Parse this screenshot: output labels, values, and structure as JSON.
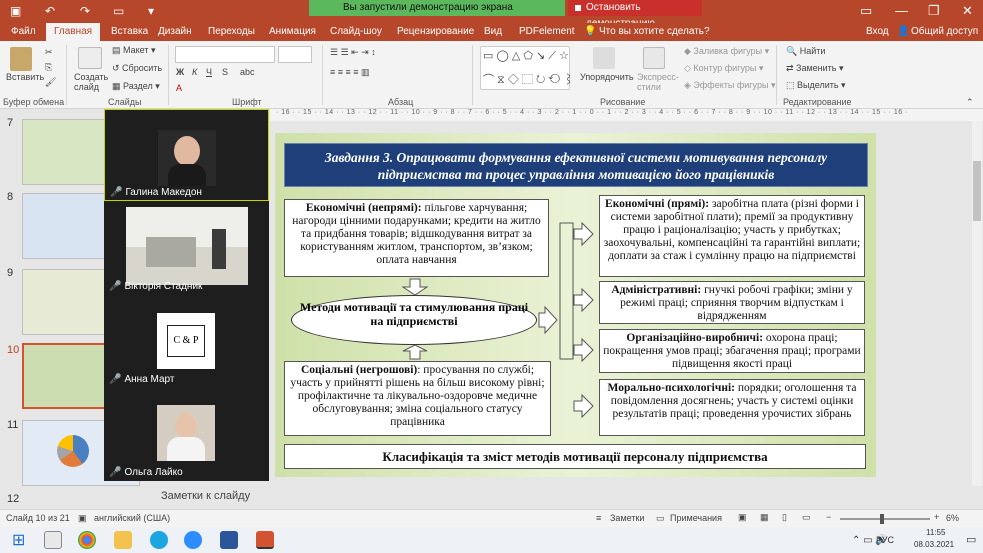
{
  "titlebar": {
    "share_banner": "Вы запустили демонстрацию экрана",
    "stop_banner": "Остановить демонстрацию"
  },
  "tabs": [
    "Файл",
    "Главная",
    "Вставка",
    "Дизайн",
    "Переходы",
    "Анимация",
    "Слайд-шоу",
    "Рецензирование",
    "Вид",
    "PDFelement"
  ],
  "tell_me": "Что вы хотите сделать?",
  "signin": "Вход",
  "share": "Общий доступ",
  "ribbon": {
    "paste": "Вставить",
    "clipboard": "Буфер обмена",
    "create_slide": "Создать слайд",
    "layout": "Макет",
    "reset": "Сбросить",
    "section": "Раздел",
    "slides": "Слайды",
    "font": "Шрифт",
    "paragraph": "Абзац",
    "arrange": "Упорядочить",
    "quick_styles": "Экспресс-стили",
    "shape_fill": "Заливка фигуры",
    "shape_outline": "Контур фигуры",
    "shape_effects": "Эффекты фигуры",
    "drawing": "Рисование",
    "find": "Найти",
    "replace": "Заменить",
    "select": "Выделить",
    "editing": "Редактирование"
  },
  "ruler_text": "· 16 · · 15 · · 14 · · 13 · · 12 · · 11 · · 10 · · 9 · · 8 · · 7 · · 6 · · 5 · · 4 · · 3 · · 2 · · 1 · · 0 · · 1 · · 2 · · 3 · · 4 · · 5 · · 6 · · 7 · · 8 · · 9 · · 10 · · 11 · · 12 · · 13 · · 14 · · 15 · · 16 ·",
  "thumbs": [
    "7",
    "8",
    "9",
    "10",
    "11",
    "12"
  ],
  "participants": [
    {
      "name": "Галина Македон"
    },
    {
      "name": "Вікторія Стадник"
    },
    {
      "name": "Анна Март",
      "logo": "C & P"
    },
    {
      "name": "Ольга Лайко"
    }
  ],
  "slide": {
    "title": "Завдання 3. Опрацювати формування ефективної системи мотивування персоналу підприємства та процес управління мотивацією його працівників",
    "econ_indirect_head": "Економічні (непрямі):",
    "econ_indirect": " пільгове харчування; нагороди цінними подарунками; кредити на житло та придбання товарів; відшкодування витрат за користуванням житлом, транспортом, зв’язком; оплата навчання",
    "methods": "Методи мотивації та стимулювання праці на підприємстві",
    "social_head": "Соціальні (негрошові)",
    "social": ": просування по службі; участь у прийнятті рішень на більш високому рівні; профілактичне та лікувально-оздоровче медичне обслуговування; зміна соціального статусу працівника",
    "econ_direct_head": "Економічні (прямі):",
    "econ_direct": " заробітна плата (різні форми і системи заробітної плати); премії за продуктивну працю і раціоналізацію; участь у прибутках; заохочувальні, компенсаційні та гарантійні виплати; доплати за стаж і сумлінну працю на підприємстві",
    "admin_head": "Адміністративні:",
    "admin": " гнучкі робочі графіки; зміни у режимі праці; сприяння творчим відпусткам і відрядженням",
    "org_head": "Організаційно-виробничі:",
    "org": " охорона праці; покращення умов праці; збагачення праці; програми підвищення якості праці",
    "moral_head": "Морально-психологічні:",
    "moral": " порядки; оголошення та повідомлення досягнень; участь у системі оцінки результатів праці; проведення урочистих зібрань",
    "footer": "Класифікація та зміст методів мотивації персоналу підприємства"
  },
  "notes_placeholder": "Заметки к слайду",
  "status": {
    "slide_info": "Слайд 10 из 21",
    "language": "английский (США)",
    "notes": "Заметки",
    "comments": "Примечания",
    "zoom": "6%"
  },
  "taskbar": {
    "lang": "РУС",
    "time": "11:55",
    "date": "08.03.2021"
  }
}
